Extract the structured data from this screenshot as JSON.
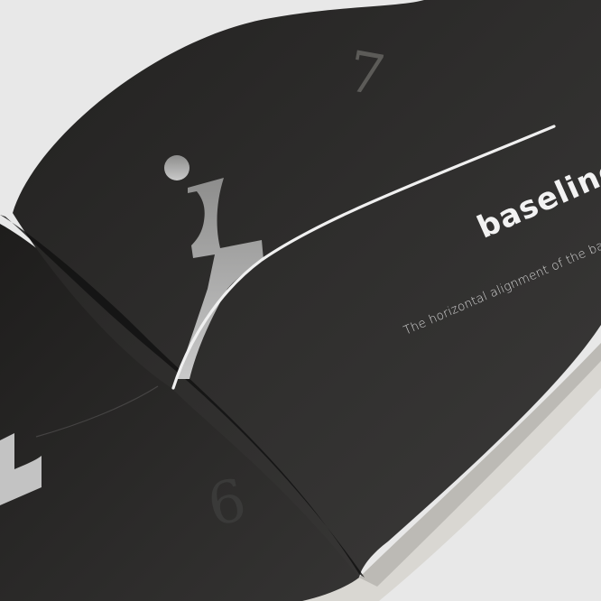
{
  "scene": {
    "background_color": "#e8e8e8",
    "page_color": "#2b2a29",
    "glyph_color": "#bfbfbf",
    "rule_color": "#f0f0f0"
  },
  "left_page": {
    "page_number": "6"
  },
  "right_page": {
    "page_number": "7",
    "headline": "baseline",
    "definition": "The horizontal alignment of the base of the le"
  }
}
